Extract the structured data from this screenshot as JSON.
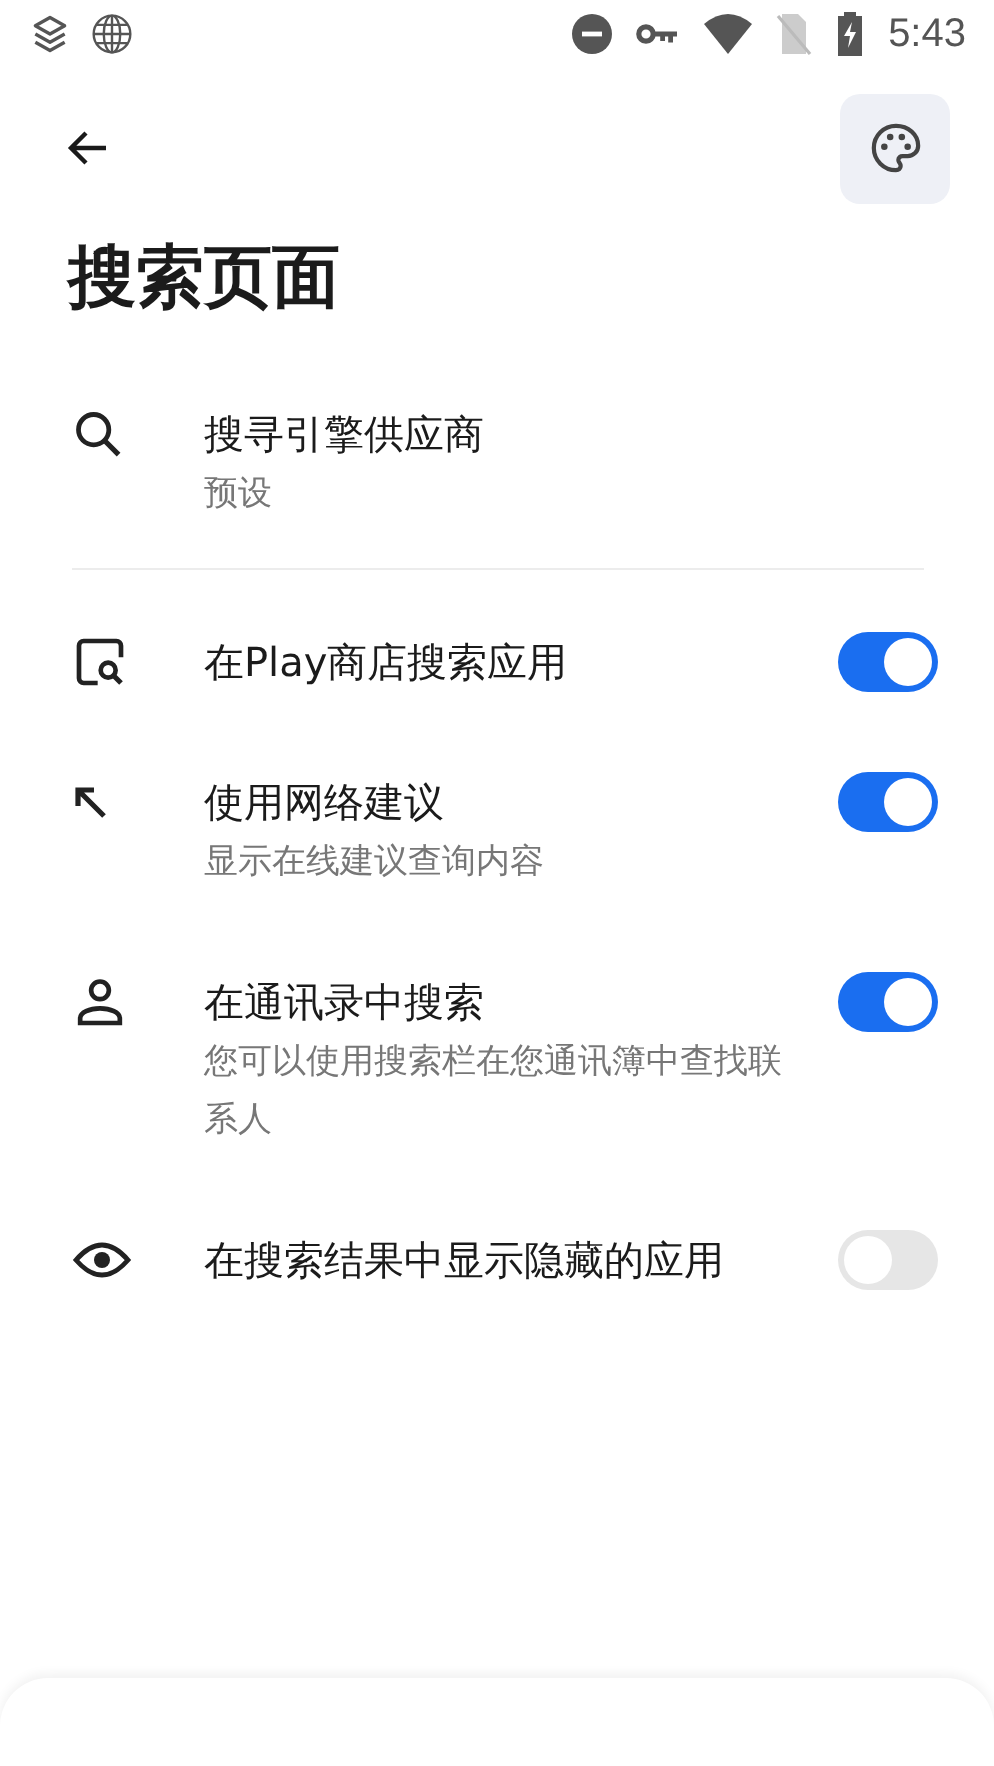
{
  "status_bar": {
    "time": "5:43"
  },
  "page_title": "搜索页面",
  "search_engine": {
    "title": "搜寻引擎供应商",
    "subtitle": "预设"
  },
  "settings": [
    {
      "title": "在Play商店搜索应用",
      "on": true
    },
    {
      "title": "使用网络建议",
      "subtitle": "显示在线建议查询内容",
      "on": true
    },
    {
      "title": "在通讯录中搜索",
      "subtitle": "您可以使用搜索栏在您通讯簿中查找联系人",
      "on": true
    },
    {
      "title": "在搜索结果中显示隐藏的应用",
      "on": false
    }
  ]
}
